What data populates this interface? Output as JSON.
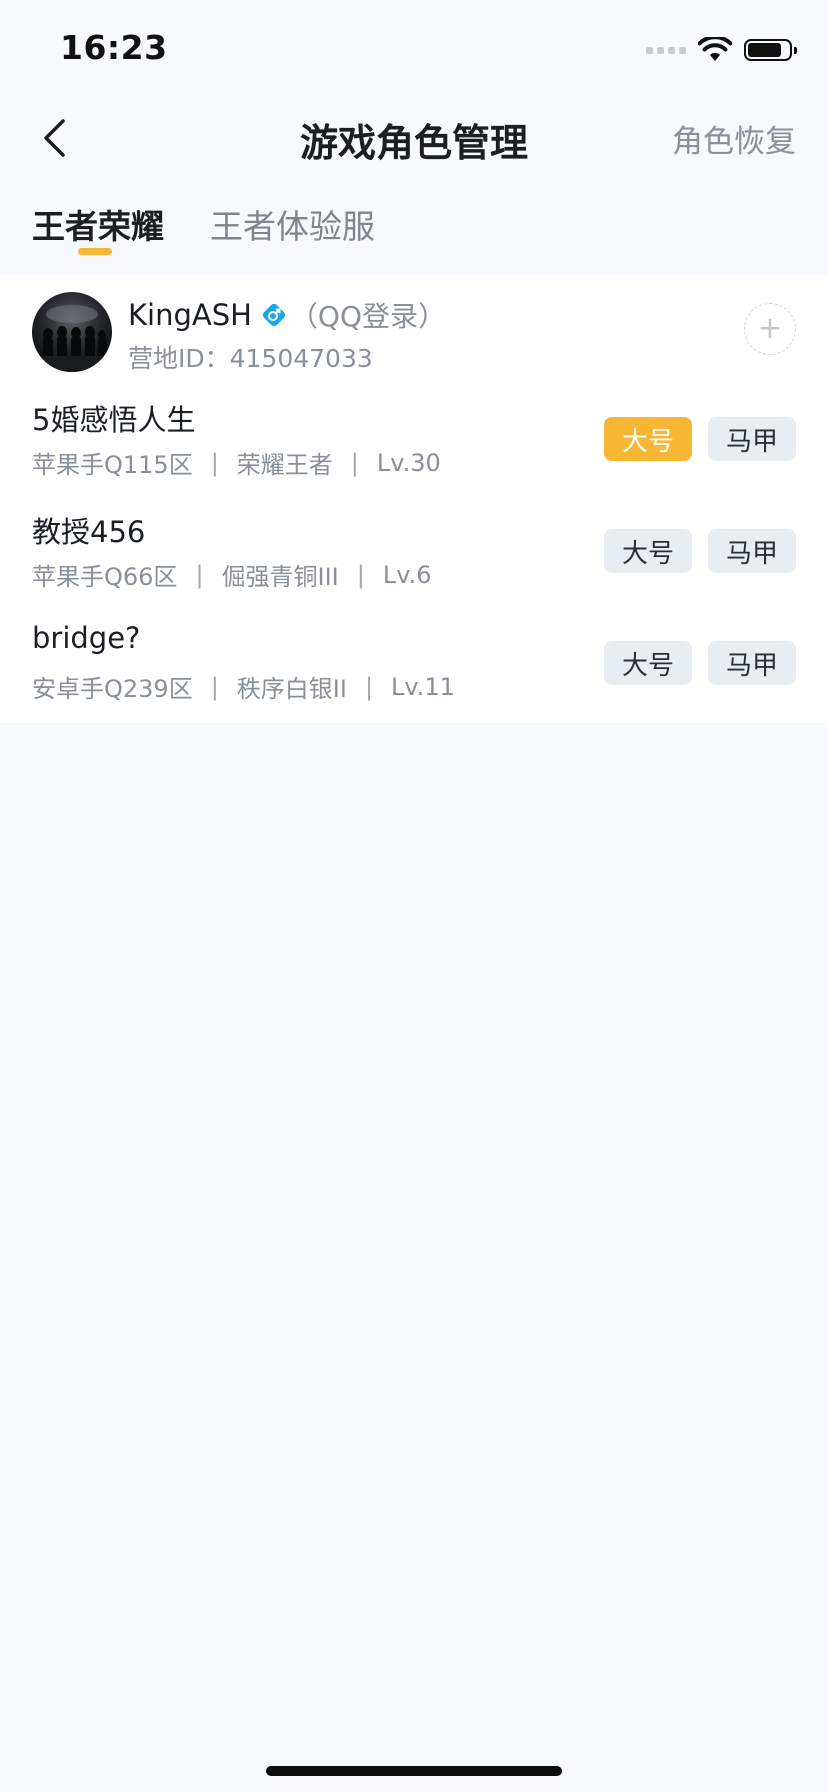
{
  "status_bar": {
    "time": "16:23"
  },
  "nav": {
    "title": "游戏角色管理",
    "restore_label": "角色恢复"
  },
  "tabs": [
    {
      "label": "王者荣耀",
      "active": true
    },
    {
      "label": "王者体验服",
      "active": false
    }
  ],
  "account": {
    "name": "KingASH",
    "login_type": "（QQ登录）",
    "camp_id": "营地ID：415047033",
    "add_symbol": "+"
  },
  "roles": [
    {
      "name": "5婚感悟人生",
      "server": "苹果手Q115区",
      "rank": "荣耀王者",
      "level": "Lv.30",
      "main_label": "大号",
      "alt_label": "马甲",
      "main_active": true
    },
    {
      "name": "教授456",
      "server": "苹果手Q66区",
      "rank": "倔强青铜III",
      "level": "Lv.6",
      "main_label": "大号",
      "alt_label": "马甲",
      "main_active": false
    },
    {
      "name": "bridge?",
      "server": "安卓手Q239区",
      "rank": "秩序白银II",
      "level": "Lv.11",
      "main_label": "大号",
      "alt_label": "马甲",
      "main_active": false
    }
  ],
  "separator": "|",
  "colors": {
    "accent": "#f7b733",
    "chip_bg": "#e8ecf3",
    "page_bg": "#f6f9fd",
    "gender_badge": "#1aa7e6"
  }
}
